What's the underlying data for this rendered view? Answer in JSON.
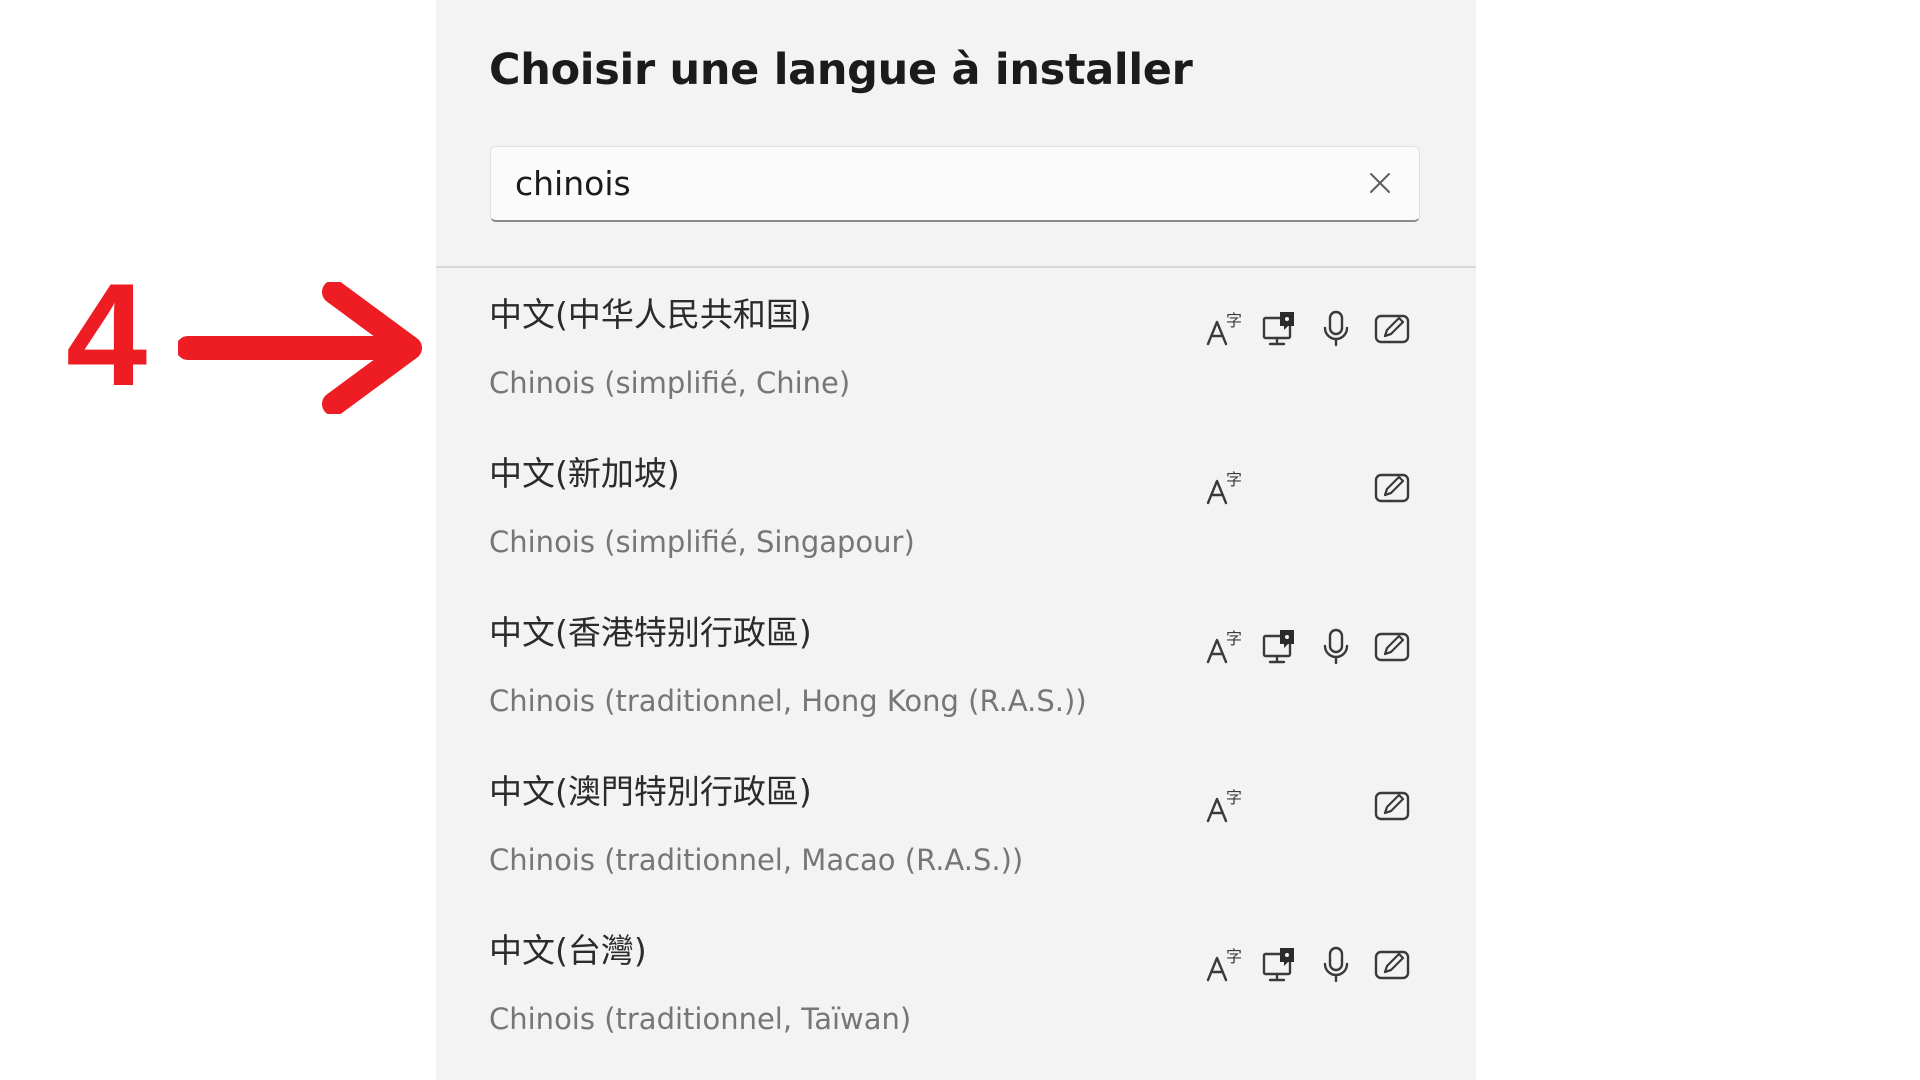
{
  "annotation": {
    "step_number": "4",
    "color": "#ee1d23"
  },
  "dialog": {
    "title": "Choisir une langue à installer",
    "search": {
      "value": "chinois",
      "clear_icon": "close-icon"
    },
    "feature_icons": [
      "text-font-icon",
      "display-language-icon",
      "microphone-icon",
      "handwriting-icon"
    ],
    "languages": [
      {
        "native_name": "中文(中华人民共和国)",
        "french_name": "Chinois (simplifié, Chine)",
        "features": {
          "font": true,
          "display": true,
          "speech": true,
          "handwriting": true
        }
      },
      {
        "native_name": "中文(新加坡)",
        "french_name": "Chinois (simplifié, Singapour)",
        "features": {
          "font": true,
          "display": false,
          "speech": false,
          "handwriting": true
        }
      },
      {
        "native_name": "中文(香港特别行政區)",
        "french_name": "Chinois (traditionnel, Hong Kong (R.A.S.))",
        "features": {
          "font": true,
          "display": true,
          "speech": true,
          "handwriting": true
        }
      },
      {
        "native_name": "中文(澳門特別行政區)",
        "french_name": "Chinois (traditionnel, Macao (R.A.S.))",
        "features": {
          "font": true,
          "display": false,
          "speech": false,
          "handwriting": true
        }
      },
      {
        "native_name": "中文(台灣)",
        "french_name": "Chinois (traditionnel, Taïwan)",
        "features": {
          "font": true,
          "display": true,
          "speech": true,
          "handwriting": true
        }
      }
    ]
  }
}
